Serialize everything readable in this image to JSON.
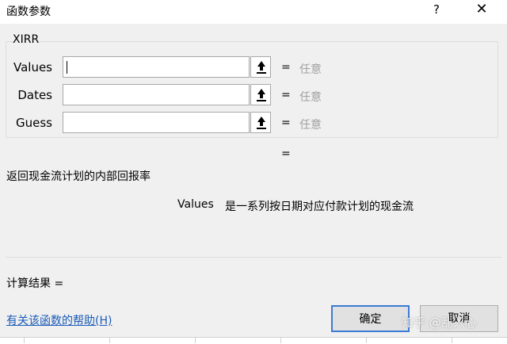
{
  "window": {
    "title": "函数参数",
    "help_glyph": "?",
    "close_glyph": "✕"
  },
  "function": {
    "name": "XIRR",
    "args": [
      {
        "label": "Values",
        "value": "",
        "result_eq": "=",
        "result": "任意"
      },
      {
        "label": "Dates",
        "value": "",
        "result_eq": "=",
        "result": "任意"
      },
      {
        "label": "Guess",
        "value": "",
        "result_eq": "=",
        "result": "任意"
      }
    ],
    "overall_eq": "=",
    "description": "返回现金流计划的内部回报率",
    "arg_help_name": "Values",
    "arg_help_text": "是一系列按日期对应付款计划的现金流"
  },
  "footer": {
    "result_label": "计算结果 =",
    "help_link": "有关该函数的帮助(H)",
    "ok_label": "确定",
    "cancel_label": "取消"
  },
  "watermark": "知乎 @乱入心",
  "icons": {
    "collapse": "collapse-dialog-icon"
  },
  "colors": {
    "accent": "#3b7bd6",
    "link": "#1a5bb8",
    "placeholder_gray": "#a0a0a0"
  }
}
